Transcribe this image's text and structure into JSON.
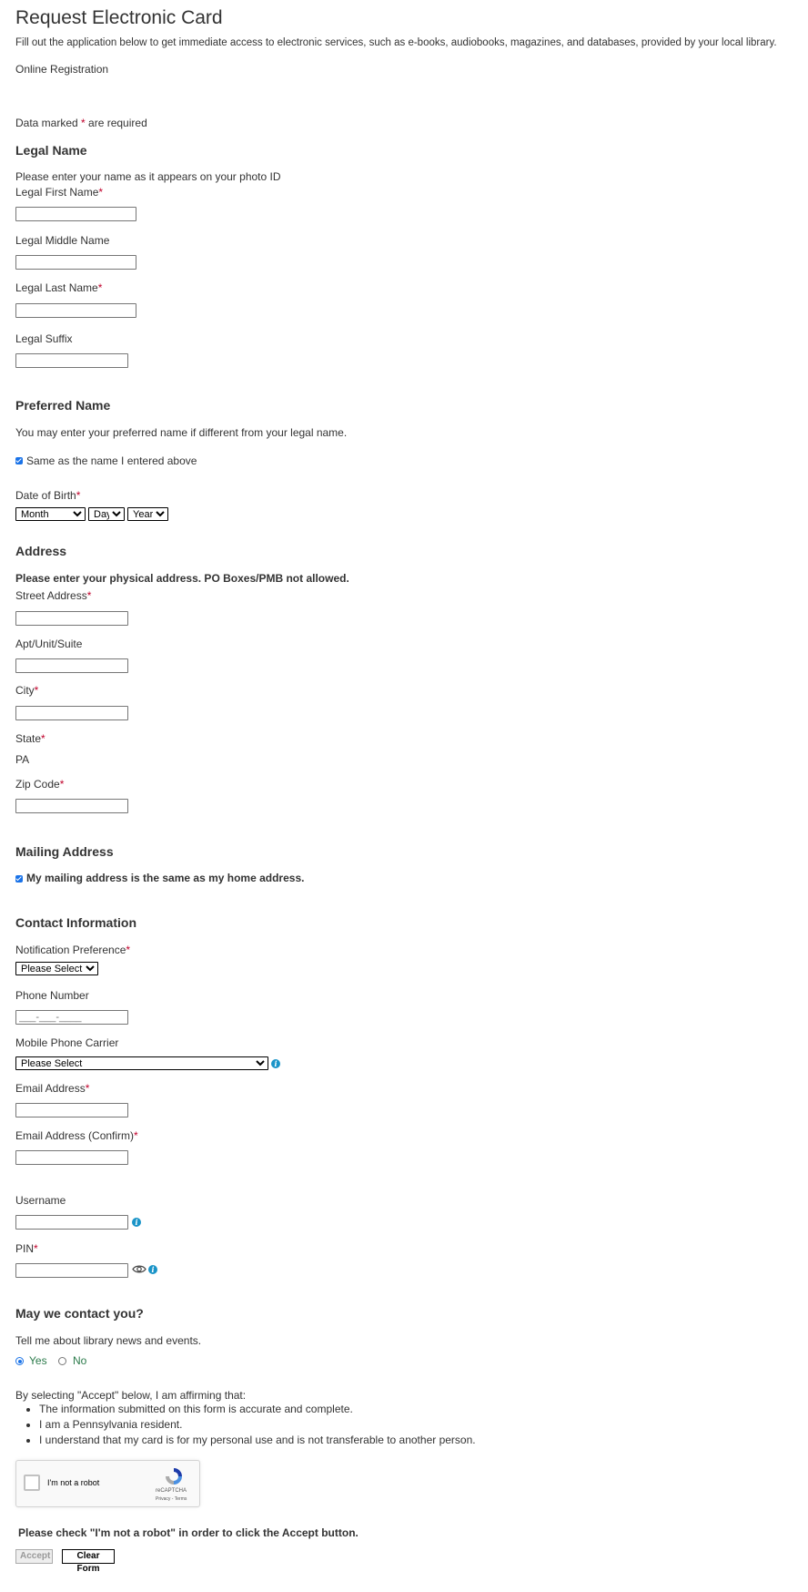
{
  "page": {
    "title": "Request Electronic Card",
    "intro": "Fill out the application below to get immediate access to electronic services, such as e-books, audiobooks, magazines, and databases, provided by your local library.",
    "subtitle": "Online Registration",
    "required_prefix": "Data marked ",
    "required_star": "*",
    "required_suffix": " are required"
  },
  "legal_name": {
    "heading": "Legal Name",
    "note": "Please enter your name as it appears on your photo ID",
    "first_label": "Legal First Name",
    "middle_label": "Legal Middle Name",
    "last_label": "Legal Last Name",
    "suffix_label": "Legal Suffix",
    "star": "*"
  },
  "preferred_name": {
    "heading": "Preferred Name",
    "note": "You may enter your preferred name if different from your legal name.",
    "same_label": "Same as the name I entered above",
    "same_checked": true
  },
  "dob": {
    "label": "Date of Birth",
    "star": "*",
    "month": "Month",
    "day": "Day",
    "year": "Year"
  },
  "address": {
    "heading": "Address",
    "note": "Please enter your physical address. PO Boxes/PMB not allowed.",
    "street_label": "Street Address",
    "apt_label": "Apt/Unit/Suite",
    "city_label": "City",
    "state_label": "State",
    "state_value": "PA",
    "zip_label": "Zip Code",
    "star": "*"
  },
  "mailing": {
    "heading": "Mailing Address",
    "same_label": "My mailing address is the same as my home address.",
    "same_checked": true
  },
  "contact": {
    "heading": "Contact Information",
    "notif_label": "Notification Preference",
    "notif_value": "Please Select",
    "phone_label": "Phone Number",
    "phone_placeholder": "___-___-____",
    "carrier_label": "Mobile Phone Carrier",
    "carrier_value": "Please Select",
    "email_label": "Email Address",
    "email_confirm_label": "Email Address (Confirm)",
    "username_label": "Username",
    "pin_label": "PIN",
    "star": "*",
    "info_glyph": "i"
  },
  "contact_pref": {
    "heading": "May we contact you?",
    "note": "Tell me about library news and events.",
    "yes_label": "Yes",
    "no_label": "No",
    "selected": "Yes"
  },
  "affirm": {
    "intro": "By selecting \"Accept\" below, I am affirming that:",
    "items": [
      "The information submitted on this form is accurate and complete.",
      "I am a Pennsylvania resident.",
      "I understand that my card is for my personal use and is not transferable to another person."
    ]
  },
  "captcha": {
    "label": "I'm not a robot",
    "brand": "reCAPTCHA",
    "links": "Privacy - Terms"
  },
  "footer": {
    "notice": "Please check \"I'm not a robot\" in order to click the Accept button.",
    "accept_label": "Accept",
    "clear_label": "Clear Form"
  }
}
